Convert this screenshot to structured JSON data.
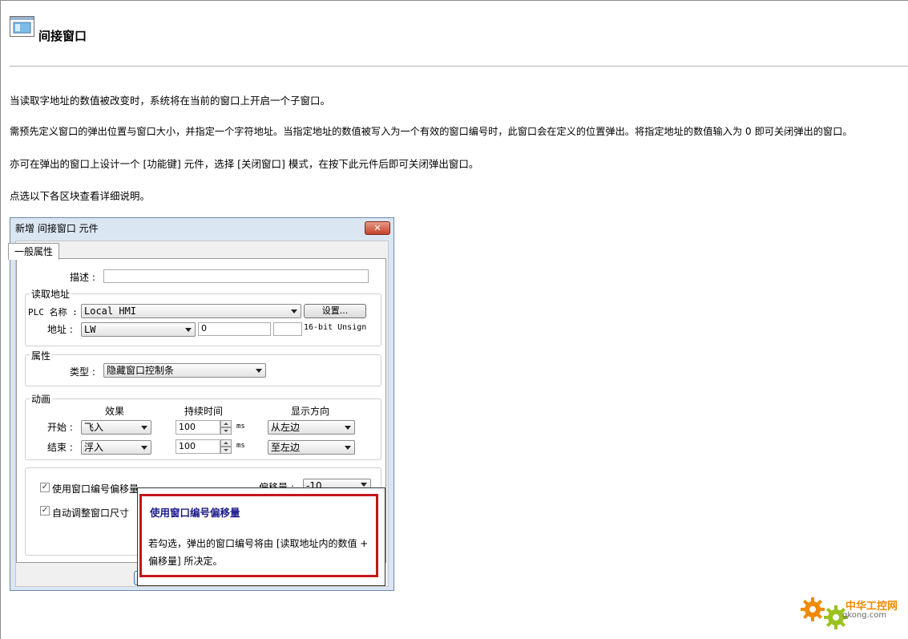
{
  "page": {
    "title": "间接窗口",
    "paragraphs": [
      "当读取字地址的数值被改变时，系统将在当前的窗口上开启一个子窗口。",
      "需预先定义窗口的弹出位置与窗口大小，并指定一个字符地址。当指定地址的数值被写入为一个有效的窗口编号时，此窗口会在定义的位置弹出。将指定地址的数值输入为 0 即可关闭弹出的窗口。",
      "亦可在弹出的窗口上设计一个 [功能键] 元件，选择 [关闭窗口] 模式，在按下此元件后即可关闭弹出窗口。",
      "点选以下各区块查看详细说明。"
    ]
  },
  "dialog": {
    "title": "新增 间接窗口 元件",
    "close_label": "✕",
    "tab_label": "一般属性",
    "desc_label": "描述 :",
    "desc_value": "",
    "read_address": {
      "group_label": "读取地址",
      "plc_label": "PLC 名称 :",
      "plc_value": "Local HMI",
      "settings_button": "设置...",
      "address_label": "地址 :",
      "device_value": "LW",
      "address_value": "0",
      "format_value": "16-bit Unsign"
    },
    "attributes": {
      "group_label": "属性",
      "type_label": "类型 :",
      "type_value": "隐藏窗口控制条"
    },
    "animation": {
      "group_label": "动画",
      "col_effect": "效果",
      "col_duration": "持续时间",
      "col_direction": "显示方向",
      "start_label": "开始 :",
      "start_effect": "飞入",
      "start_duration": "100",
      "start_unit": "ms",
      "start_direction": "从左边",
      "end_label": "结束 :",
      "end_effect": "浮入",
      "end_duration": "100",
      "end_unit": "ms",
      "end_direction": "至左边"
    },
    "options": {
      "use_offset_label": "使用窗口编号偏移量",
      "use_offset_checked": "✓",
      "offset_label": "偏移量 :",
      "offset_value": "-10",
      "auto_size_label": "自动调整窗口尺寸",
      "auto_size_checked": "✓"
    }
  },
  "tooltip": {
    "title": "使用窗口编号偏移量",
    "text": "若勾选，弹出的窗口编号将由 [读取地址内的数值 + 偏移量] 所决定。"
  },
  "watermark": {
    "name": "中华工控网",
    "url": "gkong.com"
  },
  "colors": {
    "tooltip_border": "#c4161c",
    "tooltip_title": "#1a1a8a",
    "logo_orange": "#f08a00"
  }
}
